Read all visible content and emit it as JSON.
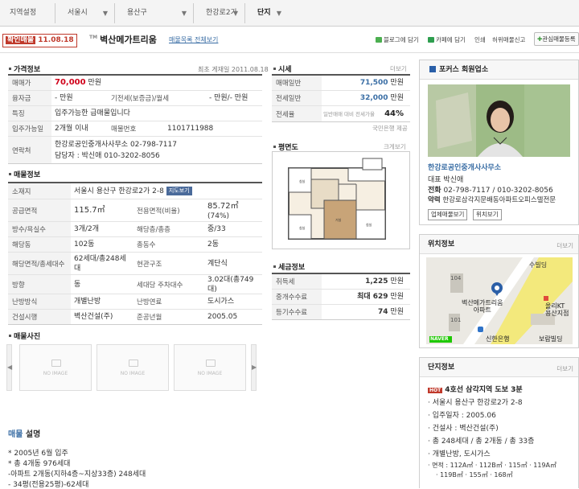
{
  "breadcrumb": [
    {
      "label": "지역설정"
    },
    {
      "label": "서울시"
    },
    {
      "label": "용산구"
    },
    {
      "label": "한강로2가"
    },
    {
      "label": "단지"
    }
  ],
  "listing": {
    "badge_prefix": "확인매물",
    "badge_date": "11.08.18",
    "tm": "TM",
    "title": "벽산메가트리움",
    "list_link": "매물목록 전체보기"
  },
  "tools": {
    "blog": "블로그에 담기",
    "cafe": "카페에 담기",
    "print": "인쇄",
    "report": "허위매물신고",
    "fav": "관심매물등록"
  },
  "price_info": {
    "heading": "가격정보",
    "posted": "최초 게재일   2011.08.18",
    "rows": {
      "sale_label": "매매가",
      "sale_price": "70,000",
      "sale_unit": "만원",
      "loan_label": "융자금",
      "loan_value": "- 만원",
      "deposit_label": "기전세(보증금)/월세",
      "deposit_value": "- 만원/- 만원",
      "feature_label": "특징",
      "feature_value": "입주가능한 급매물입니다",
      "movein_label": "입주가능일",
      "movein_value": "2개월 이내",
      "num_label": "매물번호",
      "num_value": "1101711988",
      "contact_label": "연락처",
      "contact_line1": "한강로공인중개사사무소    02-798-7117",
      "contact_line2": "담당자 : 박신애    010-3202-8056"
    }
  },
  "property_info": {
    "heading": "매물정보",
    "rows": {
      "addr_label": "소재지",
      "addr_value": "서울시 용산구 한강로2가 2-8",
      "map_btn": "지도보기",
      "area_label": "공급면적",
      "area_value": "115.7㎡",
      "excl_label": "전용면적(비율)",
      "excl_value": "85.72㎡",
      "excl_ratio": "(74%)",
      "rooms_label": "방수/욕실수",
      "rooms_value": "3개/2개",
      "floor_label": "해당층/총층",
      "floor_value": "중/33",
      "dong_label": "해당동",
      "dong_value": "102동",
      "dongs_label": "총동수",
      "dongs_value": "2동",
      "units_label": "해당면적/총세대수",
      "units_value": "62세대/총248세대",
      "entry_label": "현관구조",
      "entry_value": "계단식",
      "dir_label": "방향",
      "dir_value": "동",
      "park_label": "세대당 주차대수",
      "park_value": "3.02대(총749대)",
      "heat_label": "난방방식",
      "heat_value": "개별난방",
      "fuel_label": "난방연료",
      "fuel_value": "도시가스",
      "builder_label": "건설시행",
      "builder_value": "벽산건설(주)",
      "year_label": "준공년월",
      "year_value": "2005.05"
    }
  },
  "photos": {
    "heading": "매물사진",
    "placeholder": "NO IMAGE"
  },
  "description": {
    "heading_prefix": "매물",
    "heading_suffix": " 설명",
    "lines": [
      "* 2005년 6월 입주",
      "* 총 4개동 976세대",
      "-아파트 2개동(지하4층~지상33층) 248세대",
      "- 34평(전용25평)-62세대"
    ]
  },
  "market": {
    "heading": "시세",
    "more": "더보기",
    "avg_sale_label": "매매일반",
    "avg_sale_value": "71,500",
    "avg_sale_unit": "만원",
    "avg_jeonse_label": "전세일반",
    "avg_jeonse_value": "32,000",
    "avg_jeonse_unit": "만원",
    "ratio_label": "전세율",
    "ratio_desc": "일반매매 대비 전세가율",
    "ratio_value": "44%",
    "source": "국민은행 제공"
  },
  "floorplan": {
    "heading": "평면도",
    "more": "크게보기"
  },
  "tax": {
    "heading": "세금정보",
    "acq_label": "취득세",
    "acq_value": "1,225",
    "acq_unit": "만원",
    "fee_label": "중개수수료",
    "fee_value": "최대 629",
    "fee_unit": "만원",
    "reg_label": "등기수수료",
    "reg_value": "74",
    "reg_unit": "만원"
  },
  "agency": {
    "heading": "포커스 회원업소",
    "name": "한강로공인중개사사무소",
    "rep": "대표 박신애",
    "phone_label": "전화",
    "phone": "02-798-7117 / 010-3202-8056",
    "addr_label": "약력",
    "addr": "한강로삼각지문배동아파트오피스텔전문",
    "btn_list": "업체매물보기",
    "btn_loc": "위치보기"
  },
  "location": {
    "heading": "위치정보",
    "more": "더보기",
    "map_labels": {
      "a": "수빌딩",
      "b": "벽산메가트리움\n아파트",
      "c": "올리KT\n용산지점",
      "d": "신한은행",
      "e": "보람빌딩",
      "f": "104",
      "g": "101",
      "naver": "NAVER"
    }
  },
  "complex": {
    "heading": "단지정보",
    "more": "더보기",
    "hot": "HOT",
    "subway": "4호선 삼각지역 도보 3분",
    "items": [
      "서울시 용산구 한강로2가 2-8",
      "입주일자 : 2005.06",
      "건설사 : 벽산건설(주)",
      "총 248세대 / 총 2개동 / 총 33층",
      "개별난방, 도시가스",
      "면적 : 112A㎡ · 112B㎡ · 115㎡ · 119A㎡",
      "· 119B㎡ · 155㎡ · 168㎡"
    ]
  },
  "colors": {
    "accent_red": "#d0021b",
    "link_blue": "#3a6ea5",
    "hot_red": "#c0392b"
  }
}
